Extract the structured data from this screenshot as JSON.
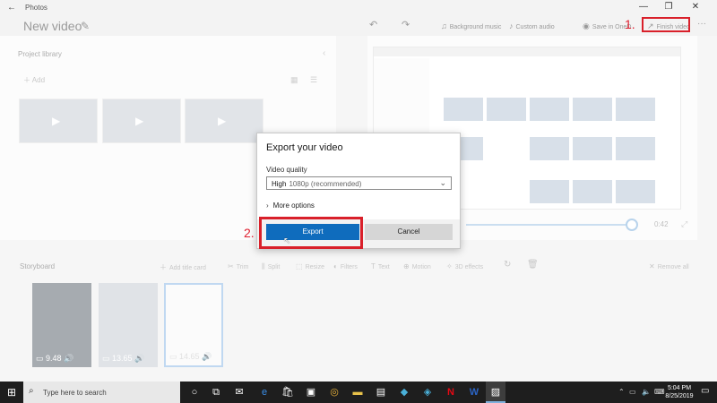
{
  "titlebar": {
    "back_glyph": "←",
    "app_name": "Photos",
    "minimize_glyph": "—",
    "maximize_glyph": "❐",
    "close_glyph": "✕"
  },
  "header": {
    "project_title": "New video",
    "undo_glyph": "↶",
    "redo_glyph": "↷",
    "background_music": "Background music",
    "custom_audio": "Custom audio",
    "save_onedrive": "Save in OneD",
    "finish_video": "Finish video",
    "more_glyph": "···"
  },
  "annotations": {
    "step1": "1.",
    "step2": "2.",
    "highlight_color": "#d9202a"
  },
  "library": {
    "title": "Project library",
    "add_label": "Add",
    "collapse_glyph": "‹"
  },
  "preview": {
    "time": "0:42"
  },
  "storyboard": {
    "title": "Storyboard",
    "tools": [
      {
        "label": "Add title card",
        "icon": "add-icon"
      },
      {
        "label": "Trim",
        "icon": "trim-icon"
      },
      {
        "label": "Split",
        "icon": "split-icon"
      },
      {
        "label": "Resize",
        "icon": "resize-icon"
      },
      {
        "label": "Filters",
        "icon": "filters-icon"
      },
      {
        "label": "Text",
        "icon": "text-icon"
      },
      {
        "label": "Motion",
        "icon": "motion-icon"
      },
      {
        "label": "3D effects",
        "icon": "effects-icon"
      }
    ],
    "remove_all": "Remove all",
    "cards": [
      {
        "duration": "9.48"
      },
      {
        "duration": "13.65"
      },
      {
        "duration": "14.65"
      }
    ]
  },
  "dialog": {
    "title": "Export your video",
    "quality_label": "Video quality",
    "quality_value_strong": "High",
    "quality_value_rest": "1080p (recommended)",
    "more_options": "More options",
    "export_label": "Export",
    "cancel_label": "Cancel",
    "accent": "#0f6cbd"
  },
  "taskbar": {
    "search_placeholder": "Type here to search",
    "clock_time": "5:04 PM",
    "clock_date": "8/25/2019"
  }
}
